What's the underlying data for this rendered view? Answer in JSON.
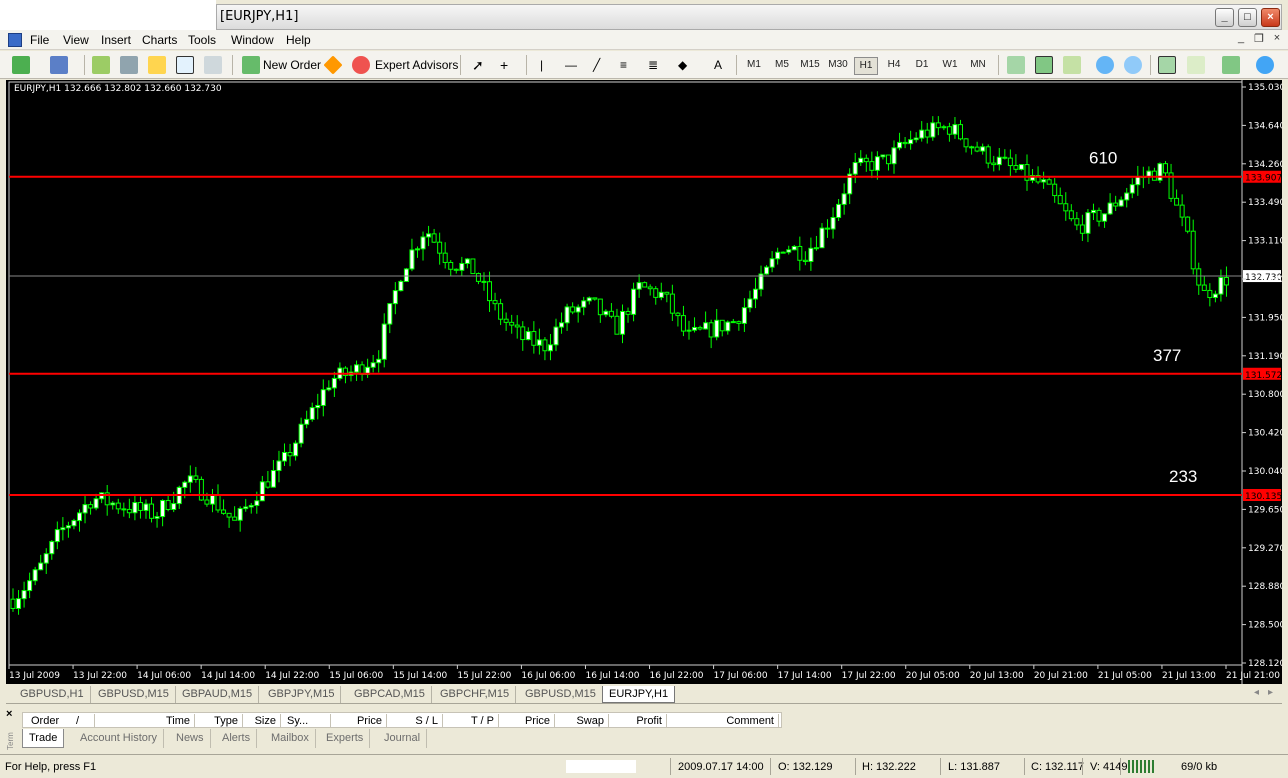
{
  "window": {
    "title": "[EURJPY,H1]"
  },
  "menu": [
    "File",
    "View",
    "Insert",
    "Charts",
    "Tools",
    "Window",
    "Help"
  ],
  "toolbar": {
    "new_order": "New Order",
    "expert_advisors": "Expert Advisors",
    "text_tool": "A",
    "timeframes": [
      "M1",
      "M5",
      "M15",
      "M30",
      "H1",
      "H4",
      "D1",
      "W1",
      "MN"
    ],
    "active_timeframe": "H1"
  },
  "chart": {
    "info": "EURJPY,H1  132.666 132.802 132.660 132.730",
    "colors": {
      "background": "#000000",
      "candle": "#00ff00",
      "bull_body": "#ffffff",
      "bear_body": "#000000",
      "level_line": "#ff0000",
      "bid_line": "#888888"
    }
  },
  "chart_data": {
    "type": "candlestick",
    "symbol": "EURJPY",
    "timeframe": "H1",
    "x_labels": [
      "13 Jul 2009",
      "13 Jul 22:00",
      "14 Jul 06:00",
      "14 Jul 14:00",
      "14 Jul 22:00",
      "15 Jul 06:00",
      "15 Jul 14:00",
      "15 Jul 22:00",
      "16 Jul 06:00",
      "16 Jul 14:00",
      "16 Jul 22:00",
      "17 Jul 06:00",
      "17 Jul 14:00",
      "17 Jul 22:00",
      "20 Jul 05:00",
      "20 Jul 13:00",
      "20 Jul 21:00",
      "21 Jul 05:00",
      "21 Jul 13:00",
      "21 Jul 21:00"
    ],
    "y_ticks": [
      "135.030",
      "134.640",
      "134.260",
      "133.490",
      "133.110",
      "132.340",
      "131.950",
      "131.190",
      "130.800",
      "130.420",
      "130.040",
      "129.650",
      "129.270",
      "128.880",
      "128.500",
      "128.120"
    ],
    "ylim": [
      128.12,
      135.03
    ],
    "current_price": {
      "value": 132.73,
      "label": "132.730"
    },
    "levels": [
      {
        "name": "610",
        "value": 133.907,
        "label": "133.907"
      },
      {
        "name": "377",
        "value": 131.572,
        "label": "131.572"
      },
      {
        "name": "233",
        "value": 130.135,
        "label": "130.135"
      }
    ],
    "close_path": [
      [
        0,
        128.9
      ],
      [
        3,
        129.2
      ],
      [
        6,
        129.7
      ],
      [
        10,
        130.1
      ],
      [
        14,
        130.0
      ],
      [
        18,
        129.9
      ],
      [
        22,
        130.3
      ],
      [
        25,
        130.1
      ],
      [
        28,
        129.8
      ],
      [
        31,
        130.2
      ],
      [
        34,
        130.5
      ],
      [
        37,
        131.0
      ],
      [
        40,
        131.5
      ],
      [
        43,
        131.6
      ],
      [
        46,
        131.8
      ],
      [
        49,
        132.8
      ],
      [
        52,
        133.3
      ],
      [
        55,
        132.9
      ],
      [
        58,
        132.8
      ],
      [
        61,
        132.3
      ],
      [
        64,
        132.0
      ],
      [
        67,
        131.9
      ],
      [
        70,
        132.3
      ],
      [
        73,
        132.4
      ],
      [
        76,
        132.1
      ],
      [
        79,
        132.6
      ],
      [
        82,
        132.5
      ],
      [
        85,
        132.0
      ],
      [
        88,
        132.1
      ],
      [
        91,
        132.2
      ],
      [
        94,
        132.6
      ],
      [
        97,
        133.1
      ],
      [
        100,
        133.0
      ],
      [
        103,
        133.4
      ],
      [
        106,
        134.0
      ],
      [
        110,
        134.1
      ],
      [
        114,
        134.4
      ],
      [
        118,
        134.5
      ],
      [
        122,
        134.2
      ],
      [
        126,
        134.0
      ],
      [
        130,
        133.8
      ],
      [
        134,
        133.3
      ],
      [
        138,
        133.5
      ],
      [
        142,
        133.9
      ],
      [
        145,
        134.0
      ],
      [
        148,
        133.2
      ],
      [
        150,
        132.5
      ],
      [
        153,
        132.7
      ]
    ]
  },
  "chart_tabs": [
    "GBPUSD,H1",
    "GBPUSD,M15",
    "GBPAUD,M15",
    "GBPJPY,M15",
    "GBPCAD,M15",
    "GBPCHF,M15",
    "GBPUSD,M15",
    "EURJPY,H1"
  ],
  "terminal": {
    "close": "×",
    "side_label": "Term",
    "columns": [
      "Order",
      "/",
      "Time",
      "Type",
      "Size",
      "Sy...",
      "Price",
      "S / L",
      "T / P",
      "Price",
      "Swap",
      "Profit",
      "Comment"
    ],
    "tabs": [
      "Trade",
      "Account History",
      "News",
      "Alerts",
      "Mailbox",
      "Experts",
      "Journal"
    ]
  },
  "status": {
    "help": "For Help, press F1",
    "datetime": "2009.07.17 14:00",
    "open": "O: 132.129",
    "high": "H: 132.222",
    "low": "L: 131.887",
    "close": "C: 132.117",
    "volume": "V: 4149",
    "traffic": "69/0 kb"
  }
}
